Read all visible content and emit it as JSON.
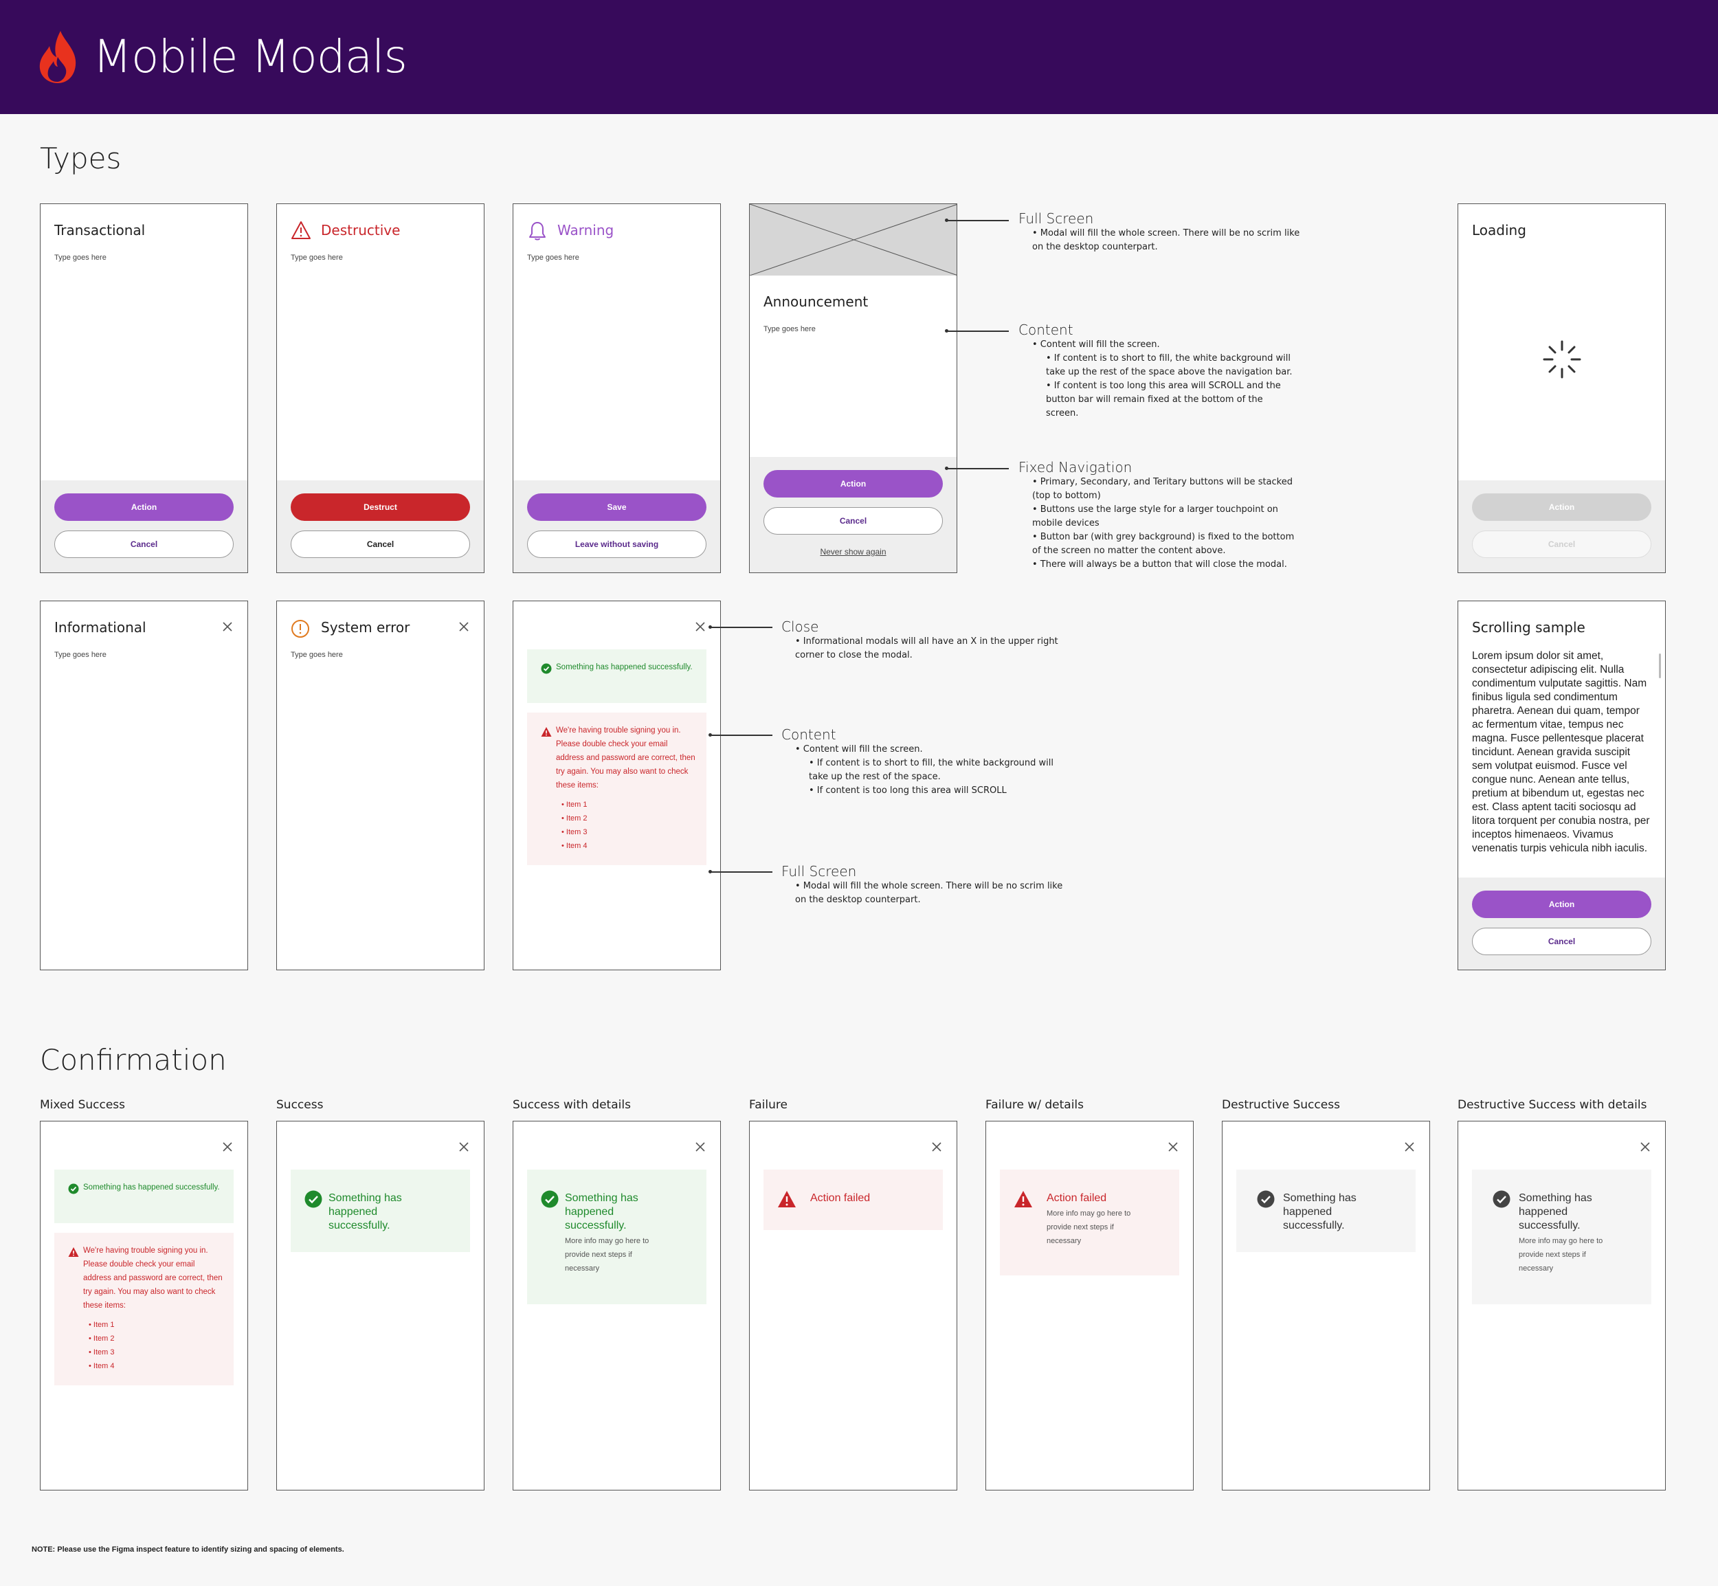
{
  "app": {
    "title": "Mobile Modals"
  },
  "sections": {
    "types": "Types",
    "confirmation": "Confirmation"
  },
  "types": {
    "transactional": {
      "title": "Transactional",
      "body": "Type goes here",
      "primary": "Action",
      "secondary": "Cancel"
    },
    "destructive": {
      "title": "Destructive",
      "body": "Type goes here",
      "primary": "Destruct",
      "secondary": "Cancel"
    },
    "warning": {
      "title": "Warning",
      "body": "Type goes here",
      "primary": "Save",
      "secondary": "Leave without saving"
    },
    "announcement": {
      "title": "Announcement",
      "body": "Type goes here",
      "primary": "Action",
      "secondary": "Cancel",
      "tertiary": "Never show again"
    },
    "loading": {
      "title": "Loading",
      "primary": "Action",
      "secondary": "Cancel"
    },
    "informational": {
      "title": "Informational",
      "body": "Type goes here"
    },
    "system_error": {
      "title": "System error",
      "body": "Type goes here"
    },
    "mixed": {
      "success": "Something has happened successfully.",
      "error": "We're having trouble signing you in. Please double check your email address and password are correct, then try again. You may also want to check these items:",
      "items": [
        "Item 1",
        "Item 2",
        "Item 3",
        "Item 4"
      ]
    },
    "scrolling": {
      "title": "Scrolling sample",
      "body": "Lorem ipsum dolor sit amet, consectetur adipiscing elit. Nulla condimentum vulputate sagittis. Nam finibus ligula sed condimentum pharetra. Aenean dui quam, tempor ac fermentum vitae, tempus nec magna. Fusce pellentesque placerat tincidunt. Aenean gravida suscipit sem volutpat euismod. Fusce vel congue nunc. Aenean ante tellus, pretium at bibendum ut, egestas nec est. Class aptent taciti sociosqu ad litora torquent per conubia nostra, per inceptos himenaeos. Vivamus venenatis turpis vehicula nibh iaculis.",
      "primary": "Action",
      "secondary": "Cancel"
    }
  },
  "notes1": {
    "full_screen": {
      "title": "Full Screen",
      "lines": [
        "• Modal will fill the whole screen. There will be no scrim like",
        "on the desktop counterpart."
      ]
    },
    "content": {
      "title": "Content",
      "lines": [
        "• Content will fill the screen.",
        "• If content is to short to fill, the white background will",
        "take up the rest of the space above the navigation bar.",
        "• If content is too long this area will SCROLL and the",
        "button bar will remain fixed at the bottom of the",
        "screen."
      ]
    },
    "fixed_nav": {
      "title": "Fixed Navigation",
      "lines": [
        "• Primary, Secondary, and Teritary buttons will be stacked",
        "(top to bottom)",
        "• Buttons use the large style for a larger touchpoint on",
        "mobile devices",
        "• Button bar (with grey background) is fixed to the bottom",
        "of the screen no matter the content above.",
        "• There will always be a button that will close the modal."
      ]
    }
  },
  "notes2": {
    "close": {
      "title": "Close",
      "lines": [
        "• Informational modals will all have an X in the upper right",
        "corner to close the modal."
      ]
    },
    "content": {
      "title": "Content",
      "lines": [
        "• Content will fill the screen.",
        "• If content is to short to fill, the white background will",
        "take up the rest of the space.",
        "• If content is too long this area will SCROLL"
      ]
    },
    "full_screen": {
      "title": "Full Screen",
      "lines": [
        "• Modal will fill the whole screen. There will be no scrim like",
        "on the desktop counterpart."
      ]
    }
  },
  "confirmation": {
    "mixed": {
      "label": "Mixed Success",
      "success": "Something has happened successfully.",
      "error": "We're having trouble signing you in. Please double check your email address and password are correct, then try again. You may also want to check these items:",
      "items": [
        "Item 1",
        "Item 2",
        "Item 3",
        "Item 4"
      ]
    },
    "success": {
      "label": "Success",
      "message": "Something has happened successfully."
    },
    "success_details": {
      "label": "Success with details",
      "message": "Something has happened successfully.",
      "details": "More info may go here to provide next steps if necessary"
    },
    "failure": {
      "label": "Failure",
      "message": "Action failed"
    },
    "failure_details": {
      "label": "Failure w/ details",
      "message": "Action failed",
      "details": "More info may go here to provide next steps if necessary"
    },
    "destructive_success": {
      "label": "Destructive Success",
      "message": "Something has happened successfully."
    },
    "destructive_details": {
      "label": "Destructive Success with details",
      "message": "Something has happened successfully.",
      "details": "More info may go here to provide next steps if necessary"
    }
  },
  "footnote": "NOTE: Please use the Figma inspect feature to identify sizing and spacing of elements.",
  "colors": {
    "header": "#370a5b",
    "primary": "#9a53c8",
    "destructive": "#c9262b",
    "success": "#1f8a2c",
    "warning": "#9a53c8",
    "system_error": "#e07a1f"
  }
}
